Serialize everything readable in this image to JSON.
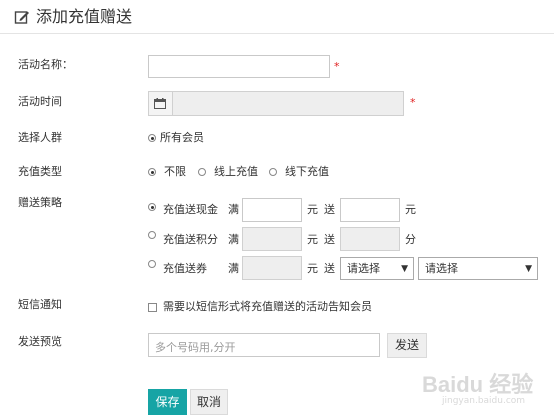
{
  "header": {
    "title": "添加充值赠送",
    "icon": "edit-icon"
  },
  "form": {
    "activity_name": {
      "label": "活动名称：",
      "value": "",
      "required": "*"
    },
    "activity_time": {
      "label": "活动时间",
      "value": "",
      "required": "*",
      "icon": "calendar-icon"
    },
    "target_group": {
      "label": "选择人群",
      "option": "所有会员",
      "selected": true
    },
    "recharge_type": {
      "label": "充值类型",
      "options": [
        "不限",
        "线上充值",
        "线下充值"
      ],
      "selected_index": 0
    },
    "strategy": {
      "label": "赠送策略",
      "rows": [
        {
          "option": "充值送现金",
          "full": "满",
          "yuan": "元",
          "give": "送",
          "unit": "元",
          "selected": true
        },
        {
          "option": "充值送积分",
          "full": "满",
          "yuan": "元",
          "give": "送",
          "unit": "分",
          "selected": false
        },
        {
          "option": "充值送券",
          "full": "满",
          "yuan": "元",
          "give": "送",
          "select1": "请选择",
          "select2": "请选择",
          "selected": false
        }
      ]
    },
    "sms": {
      "label": "短信通知",
      "checkbox_label": "需要以短信形式将充值赠送的活动告知会员",
      "checked": false
    },
    "preview": {
      "label": "发送预览",
      "placeholder": "多个号码用,分开",
      "send_button": "发送"
    }
  },
  "actions": {
    "save": "保存",
    "cancel": "取消"
  },
  "watermark": {
    "text": "Baidu 经验",
    "sub": "jingyan.baidu.com"
  },
  "colors": {
    "accent": "#16a4a5",
    "required": "#e02020"
  }
}
